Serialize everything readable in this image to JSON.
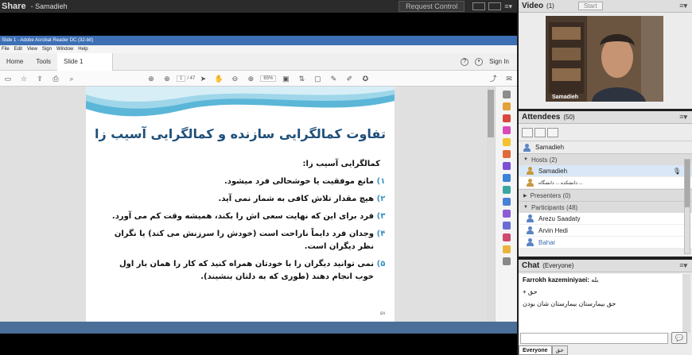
{
  "share": {
    "title": "Share",
    "presenter": "- Samadieh",
    "request_control": "Request Control"
  },
  "acrobat": {
    "window_title": "Slide 1 - Adobe Acrobat Reader DC (32-bit)",
    "menu": [
      "File",
      "Edit",
      "View",
      "Sign",
      "Window",
      "Help"
    ],
    "tabs": {
      "home": "Home",
      "tools": "Tools",
      "doc": "Slide 1"
    },
    "sign_in": "Sign In",
    "page_current": "1",
    "page_total": "/ 47",
    "zoom": "65%"
  },
  "slide": {
    "title": "تفاوت کمالگرایی سازنده و کمالگرایی آسیب زا",
    "subtitle": "کمالگرایی آسیب زا:",
    "items": [
      {
        "num": "۱)",
        "text": "مانع موفقیت یا خوشحالی فرد میشود."
      },
      {
        "num": "۲)",
        "text": "هیچ مقدار تلاش کافی به شمار نمی آید."
      },
      {
        "num": "۳)",
        "text": "فرد برای این که نهایت سعی اش را بکند، همیشه وقت کم می آورد."
      },
      {
        "num": "۴)",
        "text": "وجدان فرد دایماً ناراحت است (خودش را سرزنش می کند) یا نگران نظر دیگران است."
      },
      {
        "num": "۵)",
        "text": "نمی توانید دیگران را با خودتان همراه کنید که کار را همان بار اول خوب انجام دهند (طوری که به دلتان بنشیند)."
      }
    ],
    "page_mark": "۵۸"
  },
  "video": {
    "label": "Video",
    "count": "(1)",
    "start": "Start",
    "name": "Samadieh"
  },
  "attendees": {
    "label": "Attendees",
    "count": "(50)",
    "presenter": "Samadieh",
    "hosts_label": "Hosts (2)",
    "hosts": [
      "Samadieh",
      "دانشکده ... دانشگاه ..."
    ],
    "presenters_label": "Presenters (0)",
    "participants_label": "Participants (48)",
    "participants": [
      "Arezu Saadaty",
      "Arvin Hedi",
      "Bahar"
    ]
  },
  "chat": {
    "label": "Chat",
    "scope": "(Everyone)",
    "messages": [
      {
        "sender": "Farrokh kazeminiyaei:",
        "text": "بله"
      },
      {
        "sender": "",
        "text": "حق +"
      },
      {
        "sender": "",
        "text": "حق بیمارستان بیمارستان شان بودن"
      }
    ],
    "tabs": [
      "Everyone",
      "حق"
    ]
  }
}
